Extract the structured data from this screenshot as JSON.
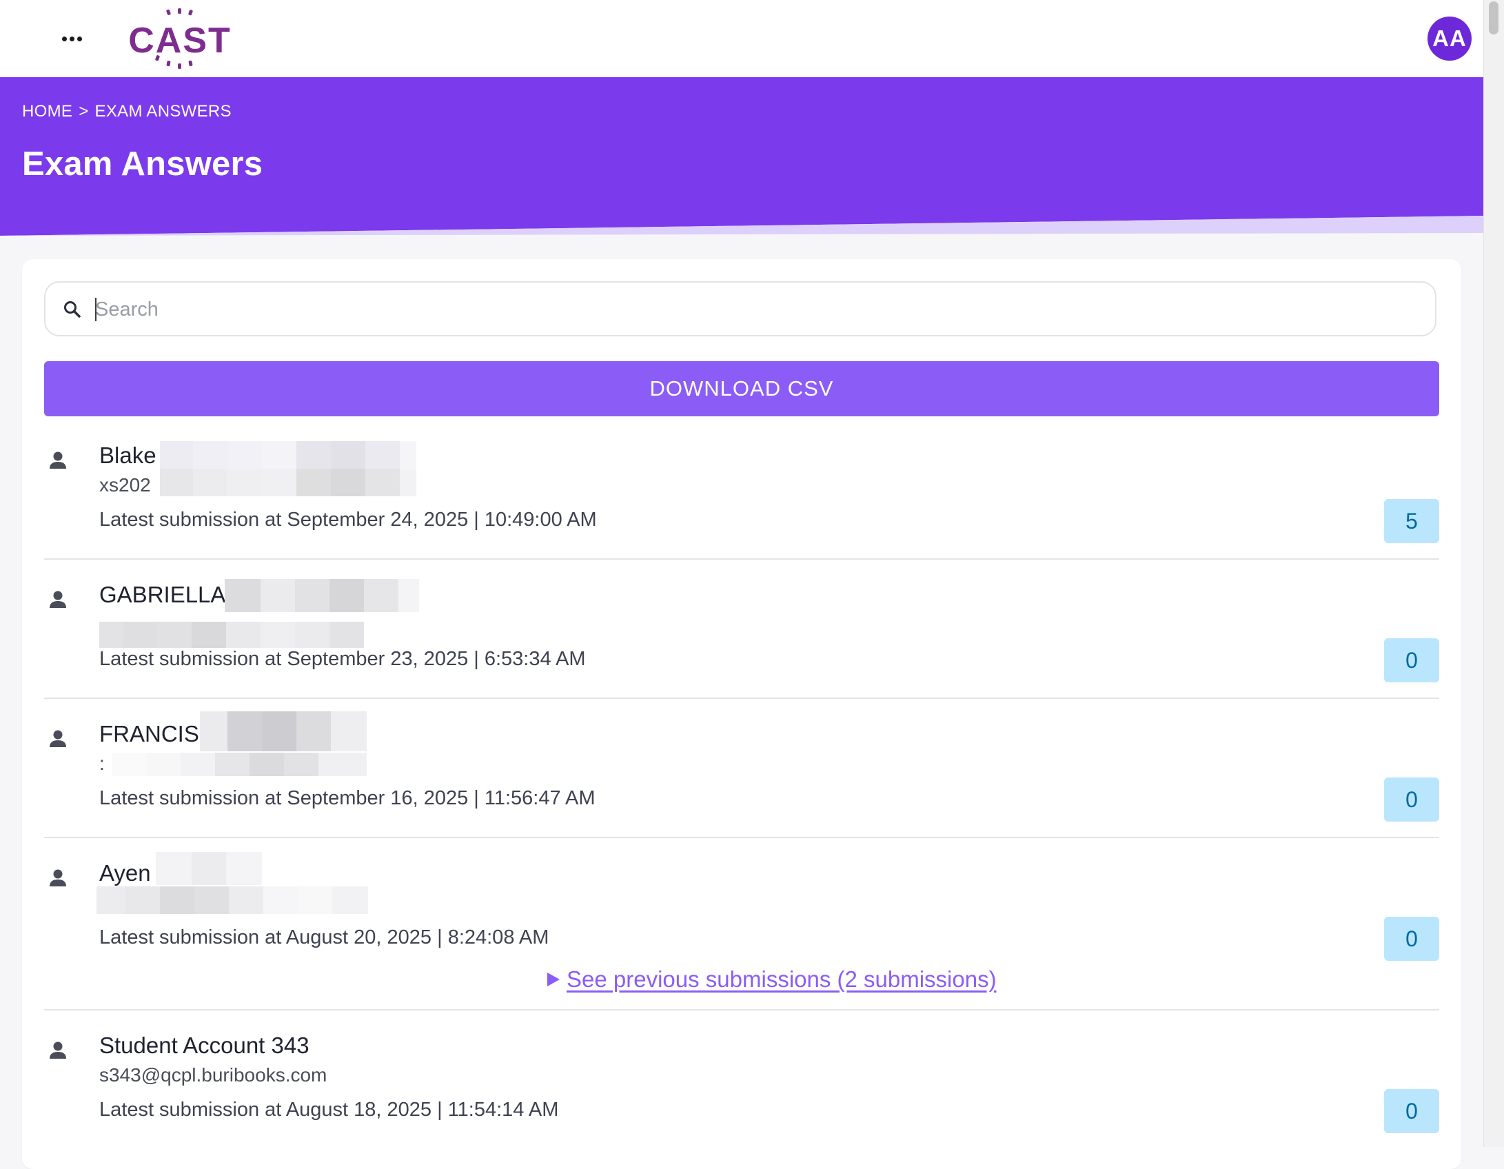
{
  "app": {
    "logo_text": "CAST",
    "avatar_initials": "AA",
    "brand_color": "#7c3aed",
    "accent_color": "#8b5cf6"
  },
  "breadcrumb": {
    "home": "HOME",
    "separator": ">",
    "current": "EXAM ANSWERS"
  },
  "page": {
    "title": "Exam Answers"
  },
  "search": {
    "placeholder": "Search",
    "value": ""
  },
  "actions": {
    "download_csv": "DOWNLOAD CSV"
  },
  "icons": {
    "menu": "more-dots-icon",
    "search": "search-icon",
    "person": "person-icon",
    "expand": "triangle-right-icon"
  },
  "submissions": [
    {
      "name": "Blake",
      "email": "xs202",
      "latest": "Latest submission at September 24, 2025 | 10:49:00 AM",
      "score": "5"
    },
    {
      "name": "GABRIELLA",
      "email": "",
      "latest": "Latest submission at September 23, 2025 | 6:53:34 AM",
      "score": "0"
    },
    {
      "name": "FRANCIS",
      "email": ":",
      "latest": "Latest submission at September 16, 2025 | 11:56:47 AM",
      "score": "0"
    },
    {
      "name": "Ayen",
      "email": "",
      "latest": "Latest submission at August 20, 2025 | 8:24:08 AM",
      "score": "0",
      "previous_link": "See previous submissions (2 submissions)"
    },
    {
      "name": "Student Account 343",
      "email": "s343@qcpl.buribooks.com",
      "latest": "Latest submission at August 18, 2025 | 11:54:14 AM",
      "score": "0"
    }
  ]
}
